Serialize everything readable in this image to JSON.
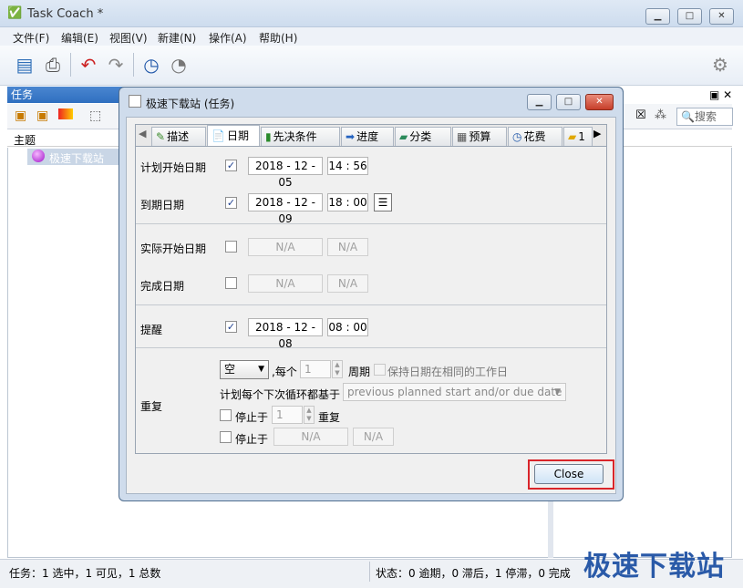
{
  "main_window": {
    "title": "Task Coach *",
    "menu": [
      "文件(F)",
      "编辑(E)",
      "视图(V)",
      "新建(N)",
      "操作(A)",
      "帮助(H)"
    ]
  },
  "task_pane": {
    "title": "任务",
    "column_subject": "主题",
    "task_name": "极速下载站",
    "search_placeholder": "搜索"
  },
  "status_bar": {
    "left": "任务：1 选中，1 可见，1 总数",
    "right": "状态：0 逾期，0 滞后，1 停滞，0 完成"
  },
  "watermark": "极速下载站",
  "dialog": {
    "title": "极速下载站 (任务)",
    "tabs": [
      "描述",
      "日期",
      "先决条件",
      "进度",
      "分类",
      "预算",
      "花费",
      "1"
    ],
    "active_tab": "日期",
    "fields": {
      "planned_start": {
        "label": "计划开始日期",
        "checked": true,
        "date": "2018 - 12 - 05",
        "time": "14 : 56"
      },
      "due": {
        "label": "到期日期",
        "checked": true,
        "date": "2018 - 12 - 09",
        "time": "18 : 00"
      },
      "actual_start": {
        "label": "实际开始日期",
        "checked": false,
        "date": "N/A",
        "time": "N/A"
      },
      "completion": {
        "label": "完成日期",
        "checked": false,
        "date": "N/A",
        "time": "N/A"
      },
      "reminder": {
        "label": "提醒",
        "checked": true,
        "date": "2018 - 12 - 08",
        "time": "08 : 00"
      }
    },
    "recurrence": {
      "label": "重复",
      "type": "空",
      "every": ",每个",
      "every_value": "1",
      "period": "周期",
      "keep_weekday": "保持日期在相同的工作日",
      "base_label": "计划每个下次循环都基于",
      "base_value": "previous planned start and/or due date",
      "stop_after": "停止于",
      "stop_after_value": "1",
      "stop_after_unit": "重复",
      "stop_at": "停止于",
      "stop_date": "N/A",
      "stop_time": "N/A"
    },
    "close_label": "Close"
  }
}
